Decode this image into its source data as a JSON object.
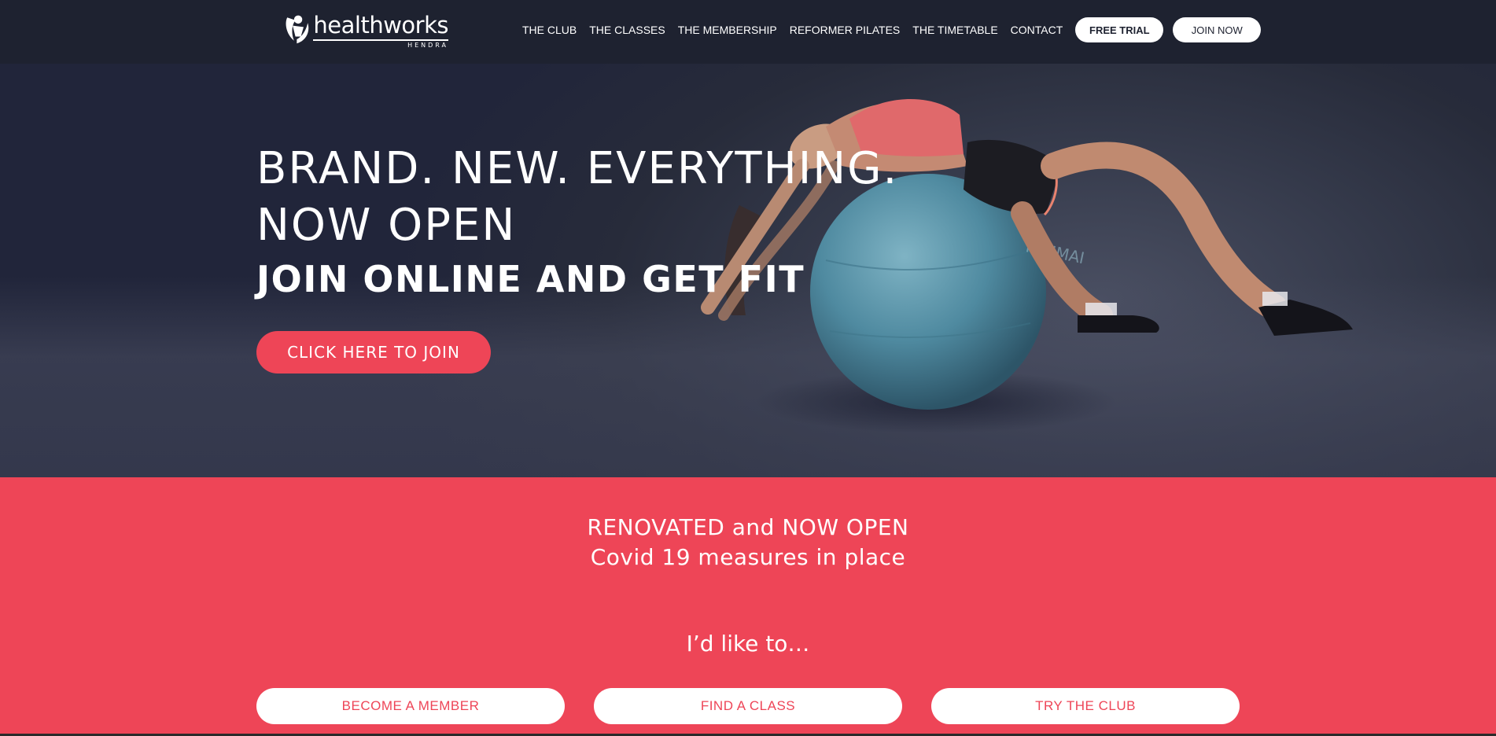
{
  "brand": {
    "name": "healthworks",
    "location": "HENDRA"
  },
  "nav": {
    "links": [
      "THE CLUB",
      "THE CLASSES",
      "THE MEMBERSHIP",
      "REFORMER PILATES",
      "THE TIMETABLE",
      "CONTACT"
    ],
    "free_trial": "FREE TRIAL",
    "join_now": "JOIN NOW"
  },
  "hero": {
    "line1": "BRAND. NEW. EVERYTHING.",
    "line2": "NOW OPEN",
    "line3": "JOIN ONLINE AND GET FIT",
    "cta": "CLICK HERE TO JOIN",
    "ball_brand": "YUNMAI"
  },
  "notice": {
    "line1": "RENOVATED and NOW OPEN",
    "line2": "Covid 19 measures in place"
  },
  "options": {
    "heading": "I’d like to…",
    "buttons": [
      "BECOME A MEMBER",
      "FIND A CLASS",
      "TRY THE CLUB"
    ]
  },
  "colors": {
    "accent": "#ee4557",
    "navy": "#1e2230",
    "white": "#ffffff"
  }
}
